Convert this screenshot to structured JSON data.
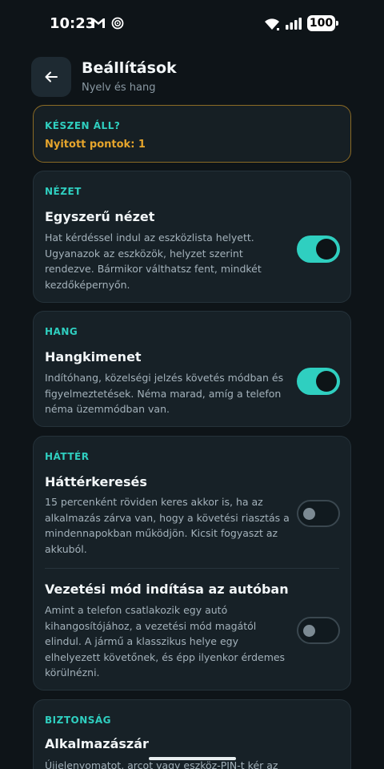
{
  "status_bar": {
    "time": "10:23",
    "battery": "100",
    "icons": [
      "gmail-icon",
      "ring-icon",
      "wifi-icon",
      "signal-icon",
      "battery-icon"
    ]
  },
  "header": {
    "title": "Beállítások",
    "subtitle": "Nyelv és hang",
    "back_icon": "back-arrow-icon"
  },
  "ready_card": {
    "label": "KÉSZEN ÁLL?",
    "open_points": "Nyitott pontok: 1"
  },
  "sections": {
    "view": {
      "label": "NÉZET",
      "title": "Egyszerű nézet",
      "desc": "Hat kérdéssel indul az eszközlista helyett. Ugyanazok az eszközök, helyzet szerint rendezve. Bármikor válthatsz fent, mindkét kezdőképernyőn.",
      "enabled": true
    },
    "sound": {
      "label": "HANG",
      "title": "Hangkimenet",
      "desc": "Indítóhang, közelségi jelzés követés módban és figyelmeztetések. Néma marad, amíg a telefon néma üzemmódban van.",
      "enabled": true
    },
    "background": {
      "label": "HÁTTÉR",
      "items": [
        {
          "title": "Háttérkeresés",
          "desc": "15 percenként röviden keres akkor is, ha az alkalmazás zárva van, hogy a követési riasztás a mindennapokban működjön. Kicsit fogyaszt az akkuból.",
          "enabled": false
        },
        {
          "title": "Vezetési mód indítása az autóban",
          "desc": "Amint a telefon csatlakozik egy autó kihangosítójához, a vezetési mód magától elindul. A jármű a klasszikus helye egy elhelyezett követőnek, és épp ilyenkor érdemes körülnézni.",
          "enabled": false
        }
      ]
    },
    "security": {
      "label": "BIZTONSÁG",
      "title": "Alkalmazászár",
      "desc": "Újjelenyomatot, arcot vagy eszköz-PIN-t kér az"
    }
  },
  "colors": {
    "accent": "#2fcfc0",
    "warning": "#e6a52c",
    "background": "#0e1418",
    "card": "#172127"
  }
}
